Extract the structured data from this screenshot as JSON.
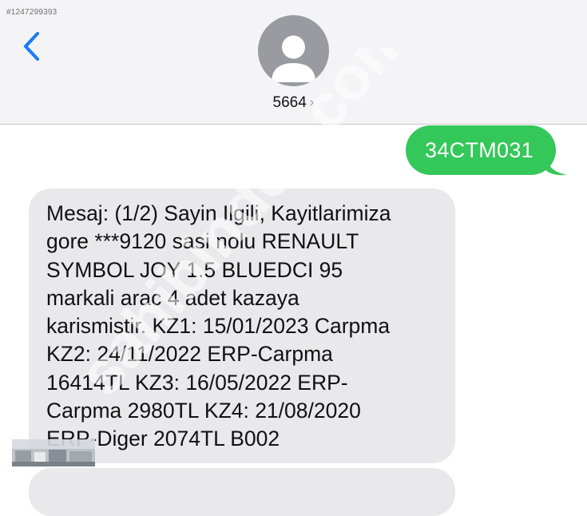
{
  "listing_id": "#1247299393",
  "header": {
    "back_icon": "chevron-left-icon",
    "avatar_icon": "person-silhouette-icon",
    "contact_name": "5664",
    "contact_chevron": "›"
  },
  "messages": {
    "sent": "34CTM031",
    "received_1": "Mesaj: (1/2) Sayin Ilgili, Kayitlarimiza\ngore ***9120 sasi nolu RENAULT\nSYMBOL JOY 1.5 BLUEDCI 95\nmarkali arac 4 adet kazaya\nkarismistir. KZ1: 15/01/2023 Carpma\nKZ2: 24/11/2022 ERP-Carpma\n16414TL KZ3: 16/05/2022 ERP-\nCarpma 2980TL KZ4: 21/08/2020\nERP-Diger 2074TL B002",
    "received_2": ""
  },
  "colors": {
    "accent": "#1a7cf5",
    "sent_bubble": "#34c759",
    "received_bubble": "#e9e9eb",
    "header_bg": "#f4f4f6",
    "avatar_bg": "#9a9ba0"
  },
  "watermark": {
    "text": "sahibinden.com"
  }
}
